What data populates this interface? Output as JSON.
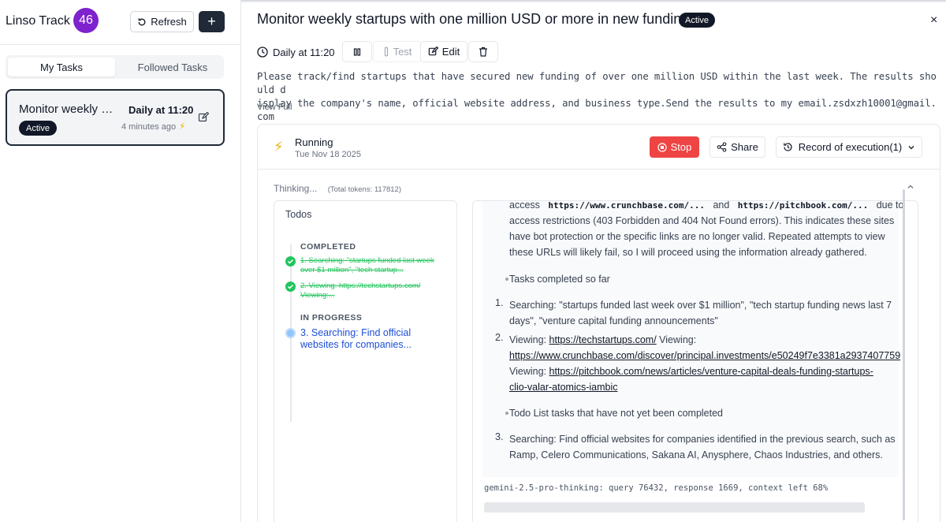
{
  "sidebar": {
    "app_title": "Linso Track",
    "badge_count": "46",
    "refresh_label": "Refresh",
    "add_label": "+",
    "tabs": [
      {
        "label": "My Tasks",
        "active": true
      },
      {
        "label": "Followed Tasks",
        "active": false
      }
    ],
    "task_card": {
      "name": "Monitor weekly s...",
      "schedule": "Daily at 11:20",
      "status": "Active",
      "ago": "4 minutes ago"
    }
  },
  "main": {
    "title": "Monitor weekly startups with one million USD or more in new funding.",
    "status": "Active",
    "close": "×",
    "schedule": "Daily at 11:20",
    "toolbar": {
      "test_label": "Test",
      "edit_label": "Edit"
    },
    "prompt_line1": "Please track/find startups that have secured new funding of over one million USD within the last week. The results should d",
    "prompt_line2": "isplay the company's name, official website address, and business type.Send the results to my email.zsdxzh10001@gmail.com",
    "view_full": "View Full"
  },
  "execution": {
    "state": "Running",
    "date": "Tue Nov 18 2025",
    "stop_label": "Stop",
    "share_label": "Share",
    "record_label": "Record of execution(1)",
    "thinking_label": "Thinking...",
    "tokens": "(Total tokens: 117812)"
  },
  "todos": {
    "title": "Todos",
    "completed_header": "COMPLETED",
    "completed": [
      "1. Searching: \"startups funded last week over $1 million\", \"tech startup...",
      "2. Viewing: https://techstartups.com/ Viewing:..."
    ],
    "in_progress_header": "IN PROGRESS",
    "in_progress": "3. Searching: Find official websites for companies..."
  },
  "detail": {
    "p1_a": "access",
    "p1_code1": "https://www.crunchbase.com/...",
    "p1_and": "and",
    "p1_code2": "https://pitchbook.com/...",
    "p1_due": "due to",
    "p1_line2": "access restrictions (403 Forbidden and 404 Not Found errors). This indicates these sites",
    "p1_line3": "have bot protection or the specific links are no longer valid. Repeated attempts to view",
    "p1_line4": "these URLs will likely fail, so I will proceed using the information already gathered.",
    "bullet1": "Tasks completed so far",
    "item1_num": "1.",
    "item1_line1": "Searching: \"startups funded last week over $1 million\", \"tech startup funding news last 7",
    "item1_line2": "days\", \"venture capital funding announcements\"",
    "item2_num": "2.",
    "item2_viewing1": "Viewing:",
    "item2_link1": "https://techstartups.com/",
    "item2_viewing2": "Viewing:",
    "item2_link2": "https://www.crunchbase.com/discover/principal.investments/e50249f7e3381a2937407759",
    "item2_viewing3": "Viewing:",
    "item2_link3a": "https://pitchbook.com/news/articles/venture-capital-deals-funding-startups-",
    "item2_link3b": "clio-valar-atomics-iambic",
    "bullet2": "Todo List tasks that have not yet been completed",
    "item3_num": "3.",
    "item3_line1": "Searching: Find official websites for companies identified in the previous search, such as",
    "item3_line2": "Ramp, Celero Communications, Sakana AI, Anysphere, Chaos Industries, and others.",
    "model_line": "gemini-2.5-pro-thinking: query 76432, response 1669, context left 68%"
  },
  "colors": {
    "accent_purple": "#7e22ce",
    "stop_red": "#ef4444",
    "completed_green": "#22c55e",
    "in_progress_blue": "#1d4ed8",
    "bolt_yellow": "#eab308"
  }
}
